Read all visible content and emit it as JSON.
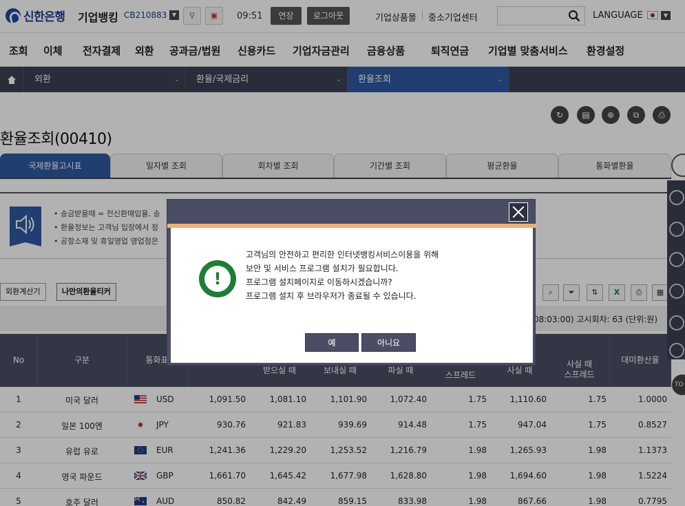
{
  "header": {
    "bank_name": "신한은행",
    "service_name": "기업뱅킹",
    "user_id": "CB210883",
    "time": "09:51",
    "extend_label": "연장",
    "logout_label": "로그아웃",
    "products_link": "기업상품몰",
    "sme_link": "중소기업센터",
    "search_placeholder": "",
    "language_label": "LANGUAGE"
  },
  "main_menu": [
    "조회",
    "이체",
    "전자결제",
    "외환",
    "공과금/법원",
    "신용카드",
    "기업자금관리",
    "금융상품",
    "퇴직연금",
    "기업별 맞춤서비스",
    "환경설정"
  ],
  "breadcrumb": [
    "외환",
    "환율/국제금리",
    "환율조회"
  ],
  "page_title": "환율조회(00410)",
  "tabs": [
    {
      "label": "국제환율고시표",
      "active": true
    },
    {
      "label": "일자별 조회",
      "active": false
    },
    {
      "label": "회차별 조회",
      "active": false
    },
    {
      "label": "기간별 조회",
      "active": false
    },
    {
      "label": "평균환율",
      "active": false
    },
    {
      "label": "통화별환율",
      "active": false
    }
  ],
  "notice_lines": [
    "• 송금받을때 = 전신환매입율, 송",
    "• 환율정보는 고객님 입장에서 정",
    "• 공항소재 및 휴일영업 영업점은"
  ],
  "action_buttons": {
    "calculator": "외환계산기",
    "my_ticker": "나만의환율티커"
  },
  "info_text": "(08:03:00) 고시회차: 63 (단위:원)",
  "table": {
    "headers": {
      "no": "No",
      "type": "구분",
      "currency": "통화표",
      "receive": "받으실 때",
      "send": "보내실 때",
      "sell": "파실 때",
      "spread_partial": "스프레드",
      "buy": "사실 때",
      "buy_spread_1": "사실 때",
      "buy_spread_2": "스프레드",
      "usd_rate": "대미환산율"
    },
    "rows": [
      {
        "no": "1",
        "name": "미국 달러",
        "code": "USD",
        "base": "1,091.50",
        "receive": "1,081.10",
        "send": "1,101.90",
        "sell": "1,072.40",
        "spread1": "1.75",
        "buy": "1,110.60",
        "spread2": "1.75",
        "usd_rate": "1.0000"
      },
      {
        "no": "2",
        "name": "일본 100엔",
        "code": "JPY",
        "base": "930.76",
        "receive": "921.83",
        "send": "939.69",
        "sell": "914.48",
        "spread1": "1.75",
        "buy": "947.04",
        "spread2": "1.75",
        "usd_rate": "0.8527"
      },
      {
        "no": "3",
        "name": "유럽 유로",
        "code": "EUR",
        "base": "1,241.36",
        "receive": "1,229.20",
        "send": "1,253.52",
        "sell": "1,216.79",
        "spread1": "1.98",
        "buy": "1,265.93",
        "spread2": "1.98",
        "usd_rate": "1.1373"
      },
      {
        "no": "4",
        "name": "영국 파운드",
        "code": "GBP",
        "base": "1,661.70",
        "receive": "1,645.42",
        "send": "1,677.98",
        "sell": "1,628.80",
        "spread1": "1.98",
        "buy": "1,694.60",
        "spread2": "1.98",
        "usd_rate": "1.5224"
      },
      {
        "no": "5",
        "name": "호주 달러",
        "code": "AUD",
        "base": "850.82",
        "receive": "842.49",
        "send": "859.15",
        "sell": "833.98",
        "spread1": "1.98",
        "buy": "867.66",
        "spread2": "1.98",
        "usd_rate": "0.7795"
      }
    ]
  },
  "side": {
    "top_label": "TO"
  },
  "dialog": {
    "lines": [
      "고객님의 안전하고 편리한 인터넷뱅킹서비스이용을 위해",
      "보안 및 서비스 프로그램 설치가 필요합니다.",
      "프로그램 설치페이지로 이동하시겠습니까?",
      "프로그램 설치 후 브라우저가 종료될 수 있습니다."
    ],
    "yes_label": "예",
    "no_label": "아니요",
    "alert_symbol": "!"
  },
  "colors": {
    "brand": "#1d3c8f",
    "nav_dark": "#3b3f52",
    "active_blue": "#2f5aa0",
    "dialog_frame": "#4a4d63",
    "alert_green": "#1e7e34"
  }
}
